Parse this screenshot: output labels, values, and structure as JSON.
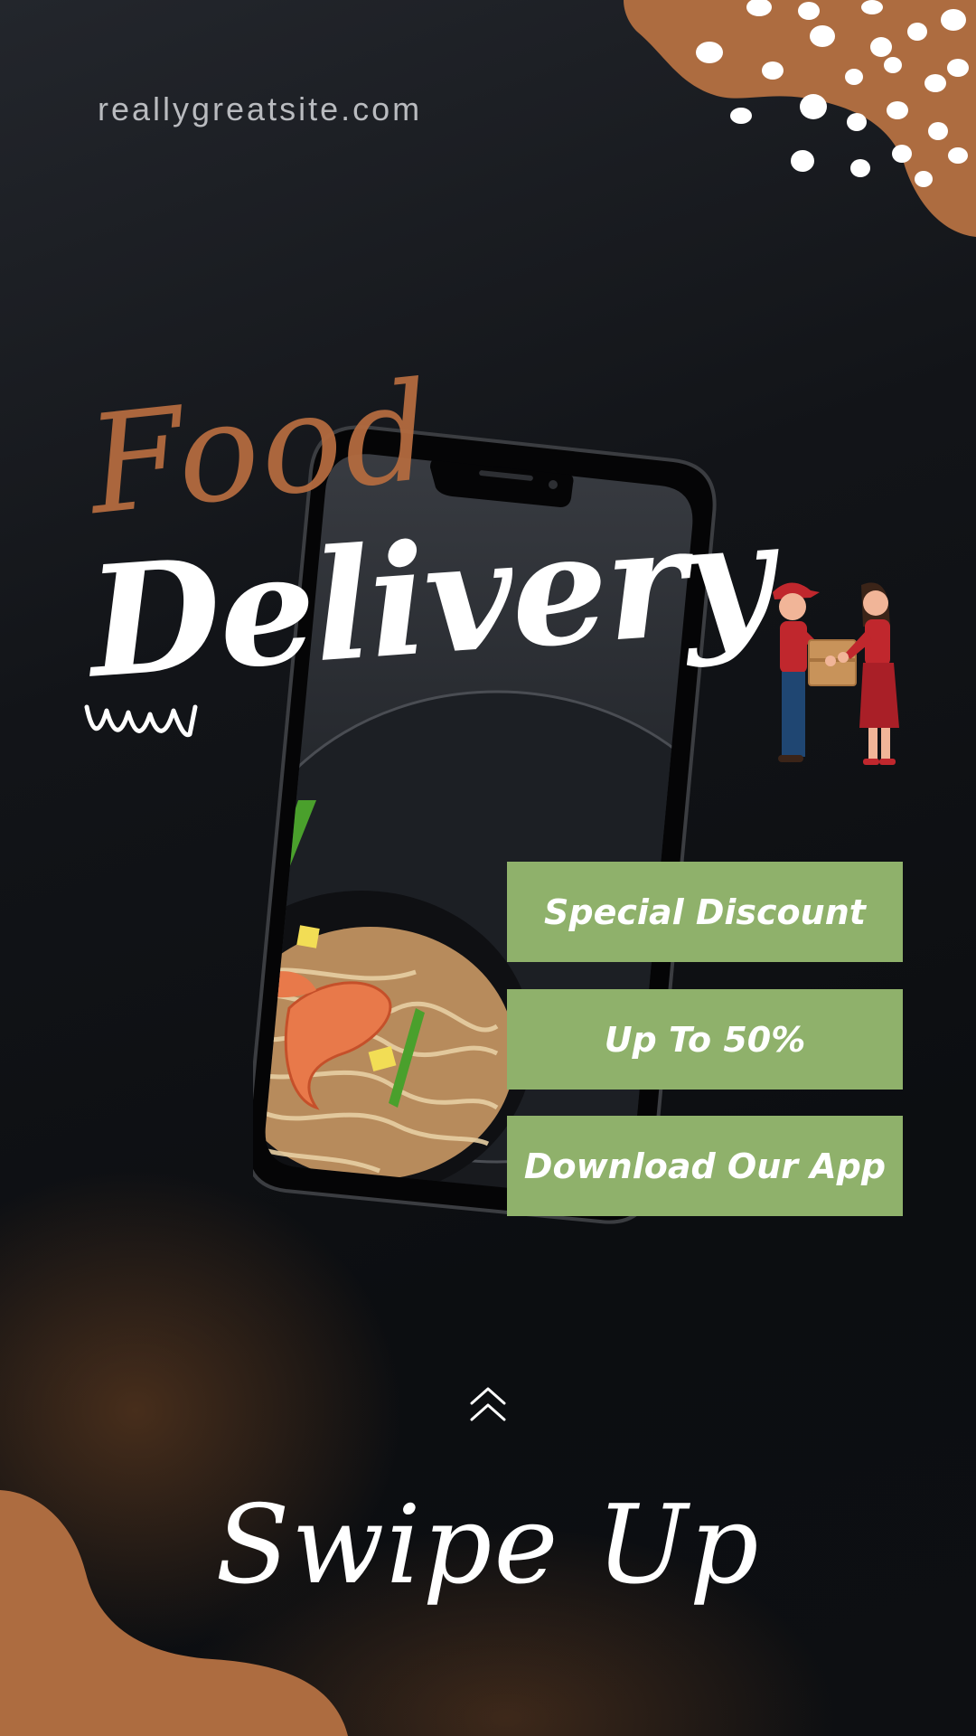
{
  "site": {
    "url": "reallygreatsite.com"
  },
  "headline": {
    "line1": "Food",
    "line2": "Delivery"
  },
  "offers": [
    {
      "label": "Special Discount"
    },
    {
      "label": "Up To 50%"
    },
    {
      "label": "Download Our App"
    }
  ],
  "swipe": {
    "label": "Swipe Up",
    "icon": "chevron-up-icon"
  },
  "illustrations": {
    "phone": "smartphone-with-noodle-dish-image",
    "courier": "delivery-person-handing-box-icon",
    "doodle": "zigzag-doodle-icon"
  },
  "colors": {
    "accent": "#b36b3f",
    "button": "#8fb16b",
    "background": "#101215",
    "text": "#ffffff"
  }
}
